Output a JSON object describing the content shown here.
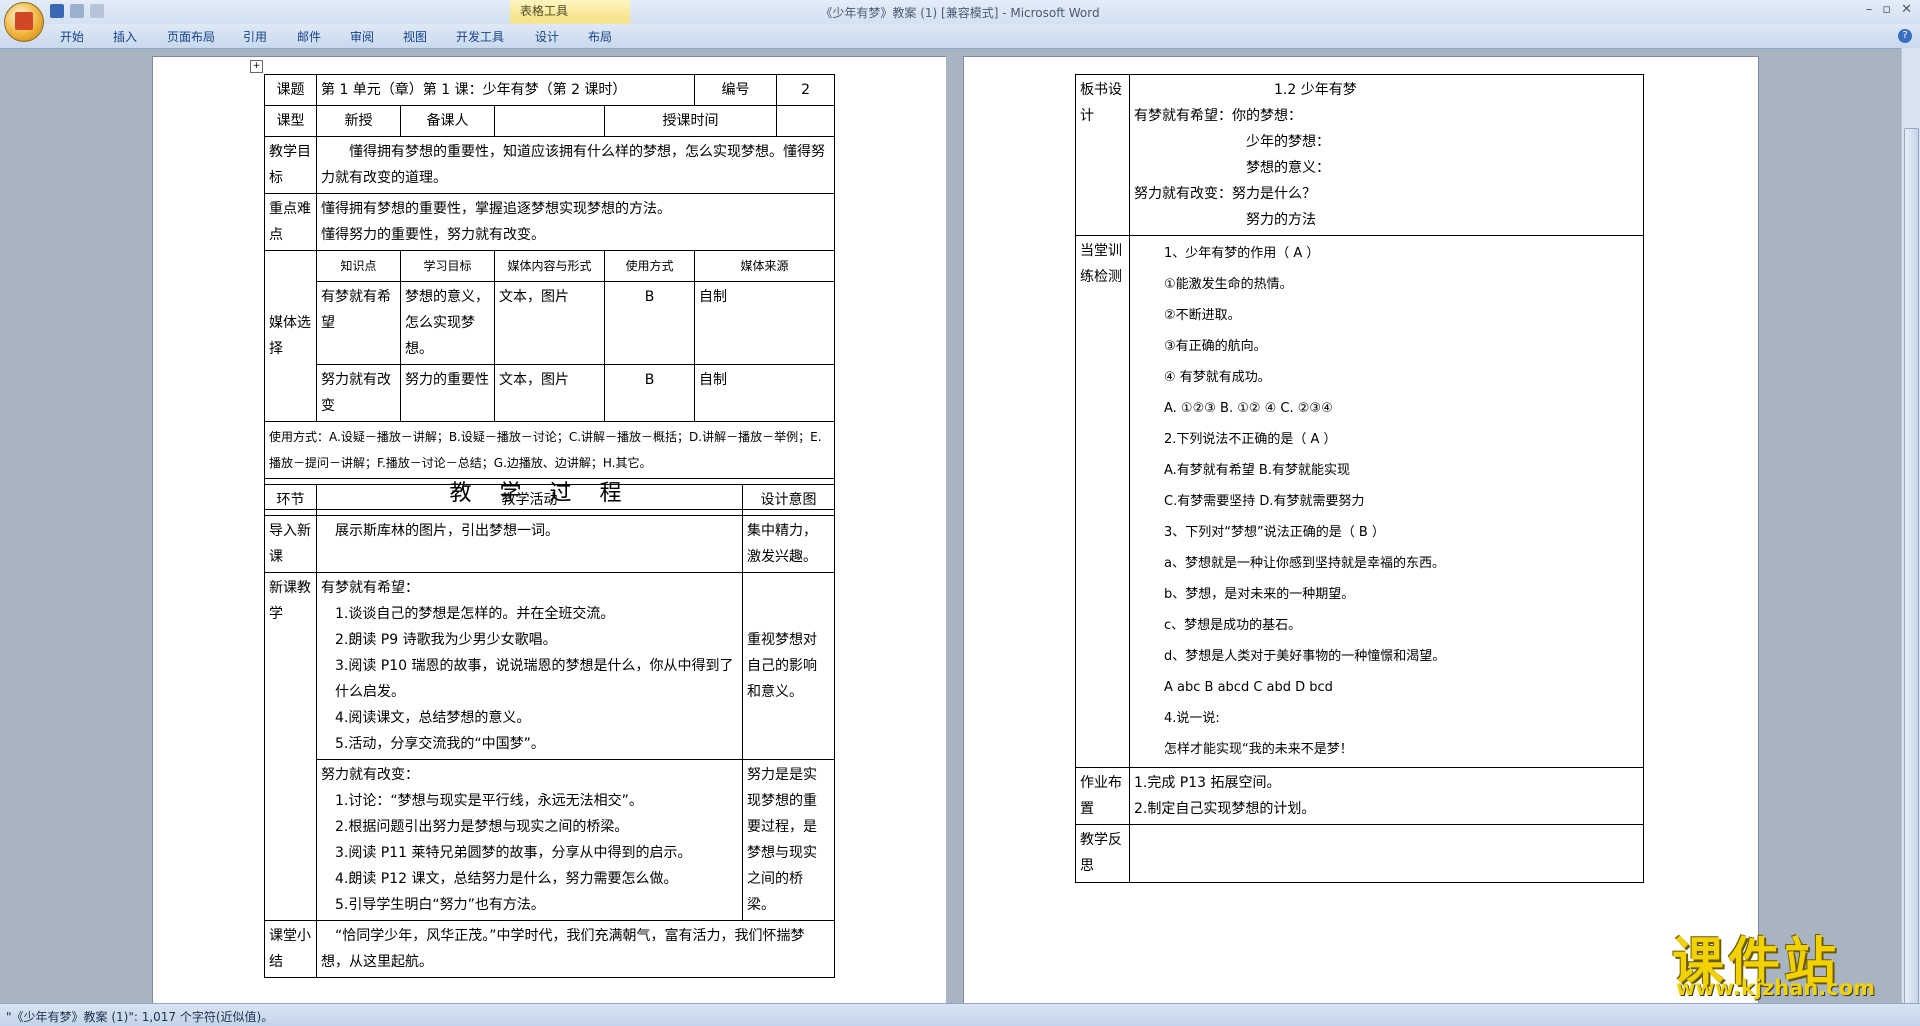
{
  "window": {
    "title": "《少年有梦》教案 (1) [兼容模式] - Microsoft Word",
    "context_tab_group": "表格工具",
    "controls": [
      "–",
      "▫",
      "✕"
    ]
  },
  "ribbon": {
    "tabs": [
      "开始",
      "插入",
      "页面布局",
      "引用",
      "邮件",
      "审阅",
      "视图",
      "开发工具",
      "设计",
      "布局"
    ]
  },
  "status": {
    "text": "\"《少年有梦》教案 (1)\": 1,017 个字符(近似值)。"
  },
  "watermark": {
    "brand": "课件站",
    "url": "www.kjzhan.com"
  },
  "page1": {
    "topic_label": "课题",
    "topic": "第 1 单元（章）第 1 课：少年有梦（第 2 课时）",
    "num_label": "编号",
    "num": "2",
    "type_label": "课型",
    "type": "新授",
    "preparer_label": "备课人",
    "time_label": "授课时间",
    "goal_label": "教学目标",
    "goal": "懂得拥有梦想的重要性，知道应该拥有什么样的梦想，怎么实现梦想。懂得努力就有改变的道理。",
    "key_label": "重点难点",
    "key1": "懂得拥有梦想的重要性，掌握追逐梦想实现梦想的方法。",
    "key2": "懂得努力的重要性，努力就有改变。",
    "media_label": "媒体选择",
    "media_headers": [
      "知识点",
      "学习目标",
      "媒体内容与形式",
      "使用方式",
      "媒体来源"
    ],
    "media_rows": [
      [
        "有梦就有希望",
        "梦想的意义，怎么实现梦想。",
        "文本，图片",
        "B",
        "自制"
      ],
      [
        "努力就有改变",
        "努力的重要性",
        "文本，图片",
        "B",
        "自制"
      ]
    ],
    "usage": "使用方式：A.设疑－播放－讲解；B.设疑－播放－讨论；C.讲解－播放－概括；D.讲解－播放－举例；E.播放－提问－讲解；F.播放－讨论－总结；G.边播放、边讲解；H.其它。",
    "process_title": "教学过程",
    "proc_headers": [
      "环节",
      "教学活动",
      "设计意图"
    ],
    "intro_label": "导入新课",
    "intro": "展示斯库林的图片，引出梦想一词。",
    "intro_intent": "集中精力，激发兴趣。",
    "new_label": "新课教学",
    "part1_title": "有梦就有希望：",
    "part1_items": [
      "1.谈谈自己的梦想是怎样的。并在全班交流。",
      "2.朗读 P9 诗歌我为少男少女歌唱。",
      "3.阅读 P10 瑞恩的故事，说说瑞恩的梦想是什么，你从中得到了什么启发。",
      "4.阅读课文，总结梦想的意义。",
      "5.活动，分享交流我的“中国梦”。"
    ],
    "part1_intent": "重视梦想对自己的影响和意义。",
    "part2_title": "努力就有改变：",
    "part2_items": [
      "1.讨论：“梦想与现实是平行线，永远无法相交”。",
      "2.根据问题引出努力是梦想与现实之间的桥梁。",
      "3.阅读 P11 莱特兄弟圆梦的故事，分享从中得到的启示。",
      "4.朗读 P12 课文，总结努力是什么，努力需要怎么做。",
      "5.引导学生明白“努力”也有方法。"
    ],
    "part2_intent": "努力是是实现梦想的重要过程，是梦想与现实之间的桥梁。",
    "summary_label": "课堂小结",
    "summary": "“恰同学少年，风华正茂。”中学时代，我们充满朝气，富有活力，我们怀揣梦想，从这里起航。"
  },
  "page2": {
    "board_label": "板书设计",
    "board_title": "1.2 少年有梦",
    "board_lines": [
      "有梦就有希望：你的梦想：",
      "少年的梦想：",
      "梦想的意义：",
      "努力就有改变：努力是什么？",
      "努力的方法"
    ],
    "practice_label": "当堂训练检测",
    "practice_lines": [
      "1、少年有梦的作用（ A ）",
      "①能激发生命的热情。",
      "②不断进取。",
      "③有正确的航向。",
      "④ 有梦就有成功。",
      "A. ①②③    B. ①② ④     C. ②③④",
      "2.下列说法不正确的是（ A ）",
      "A.有梦就有希望      B.有梦就能实现",
      "C.有梦需要坚持     D.有梦就需要努力",
      "3、下列对“梦想”说法正确的是（ B ）",
      "a、梦想就是一种让你感到坚持就是幸福的东西。",
      "b、梦想，是对未来的一种期望。",
      "c、梦想是成功的基石。",
      "d、梦想是人类对于美好事物的一种憧憬和渴望。",
      "A   abc       B   abcd        C   abd        D   bcd",
      "4.说一说:",
      "怎样才能实现“我的未来不是梦！"
    ],
    "homework_label": "作业布置",
    "homework": [
      "1.完成 P13 拓展空间。",
      "2.制定自己实现梦想的计划。"
    ],
    "reflection_label": "教学反思"
  }
}
